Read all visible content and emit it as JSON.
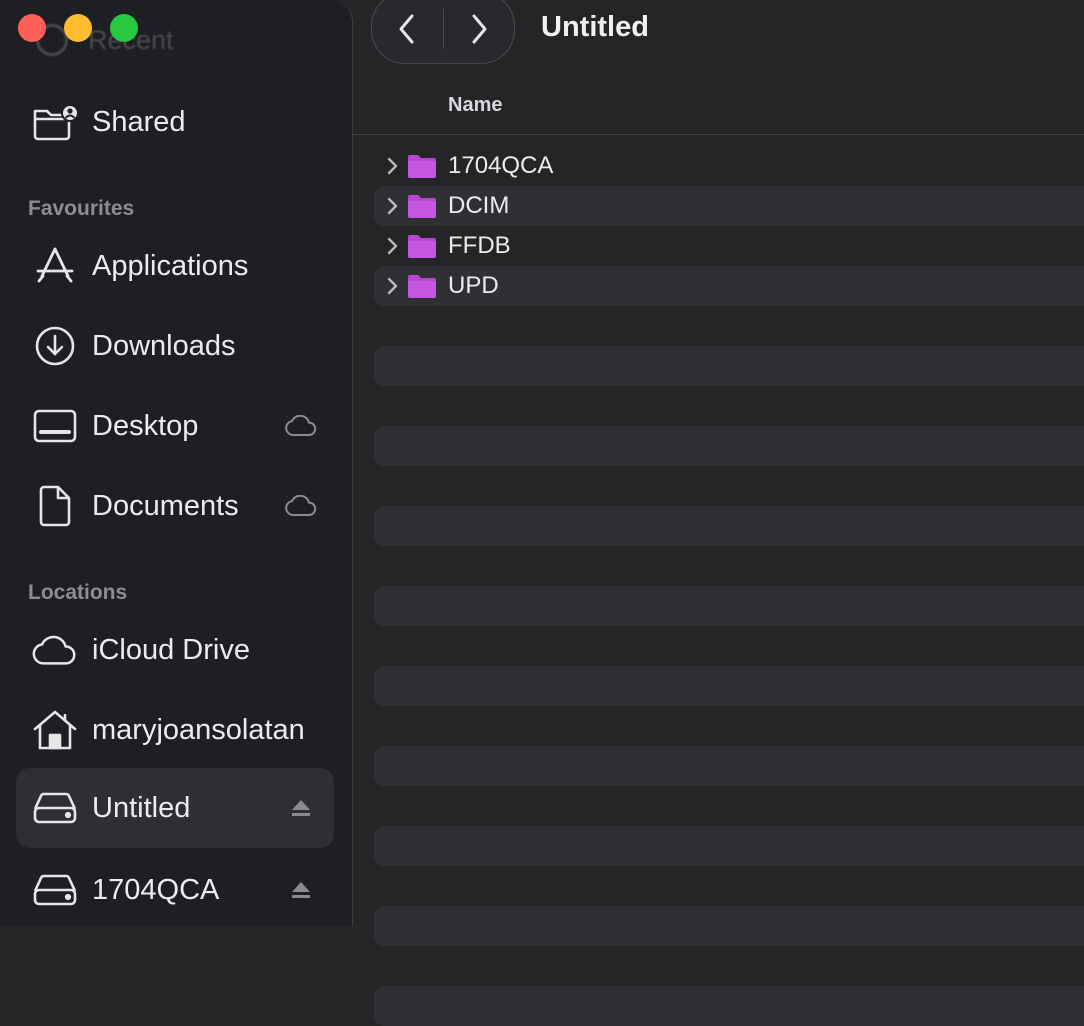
{
  "window": {
    "title": "Untitled",
    "traffic_lights": {
      "close": "#fe5f57",
      "minimize": "#febc2e",
      "maximize": "#28c840"
    }
  },
  "sidebar": {
    "ghost_item": {
      "label": "Recent",
      "icon": "clock-icon"
    },
    "top_items": [
      {
        "label": "Shared",
        "icon": "shared-folder-icon"
      }
    ],
    "sections": [
      {
        "heading": "Favourites",
        "items": [
          {
            "label": "Applications",
            "icon": "applications-icon"
          },
          {
            "label": "Downloads",
            "icon": "download-circle-icon"
          },
          {
            "label": "Desktop",
            "icon": "desktop-icon",
            "trailing_icon": "icloud-status-icon"
          },
          {
            "label": "Documents",
            "icon": "document-icon",
            "trailing_icon": "icloud-status-icon"
          }
        ]
      },
      {
        "heading": "Locations",
        "items": [
          {
            "label": "iCloud Drive",
            "icon": "cloud-icon"
          },
          {
            "label": "maryjoansolatan",
            "icon": "home-icon"
          },
          {
            "label": "Untitled",
            "icon": "drive-icon",
            "trailing_icon": "eject-icon",
            "selected": true
          },
          {
            "label": "1704QCA",
            "icon": "drive-icon",
            "trailing_icon": "eject-icon"
          }
        ]
      }
    ]
  },
  "list": {
    "column_header": "Name",
    "items": [
      {
        "name": "1704QCA",
        "kind": "folder"
      },
      {
        "name": "DCIM",
        "kind": "folder"
      },
      {
        "name": "FFDB",
        "kind": "folder"
      },
      {
        "name": "UPD",
        "kind": "folder"
      }
    ],
    "folder_color": "#c04ede",
    "stripe_color": "#2f3033"
  }
}
